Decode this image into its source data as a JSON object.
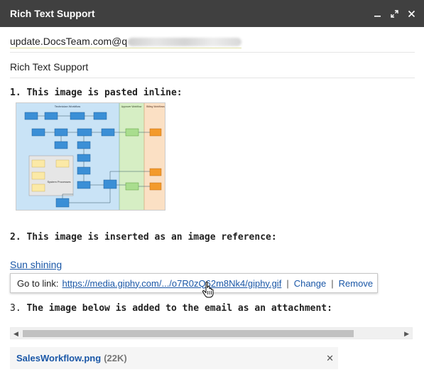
{
  "window": {
    "title": "Rich Text Support",
    "controls": [
      "minimize-icon",
      "expand-icon",
      "close-icon"
    ],
    "titlebar_color": "#404040"
  },
  "compose": {
    "to_visible": "update.DocsTeam.com@q",
    "subject": "Rich Text Support"
  },
  "body": {
    "line1": "1. This image is pasted inline:",
    "line2": "2. This image is inserted as an image reference:",
    "link_text": "Sun shining",
    "popup": {
      "goto_label": "Go to link:",
      "url": "https://media.giphy.com/.../o7R0zQ62m8Nk4/giphy.gif",
      "change": "Change",
      "remove": "Remove"
    },
    "line3_prefix": "3.",
    "line3_rest": "The image below is added to the email as an attachment:"
  },
  "diagram": {
    "lanes": [
      "Technician Workflow",
      "Approver Workflow",
      "Billing Workflows"
    ],
    "system_label": "System Processes"
  },
  "attachment": {
    "filename": "SalesWorkflow.png",
    "size": "(22K)"
  },
  "colors": {
    "link": "#1a57a7",
    "lane_blue": "#c9e3f6",
    "lane_green": "#d6eec4",
    "lane_orange": "#fbe0c4"
  }
}
